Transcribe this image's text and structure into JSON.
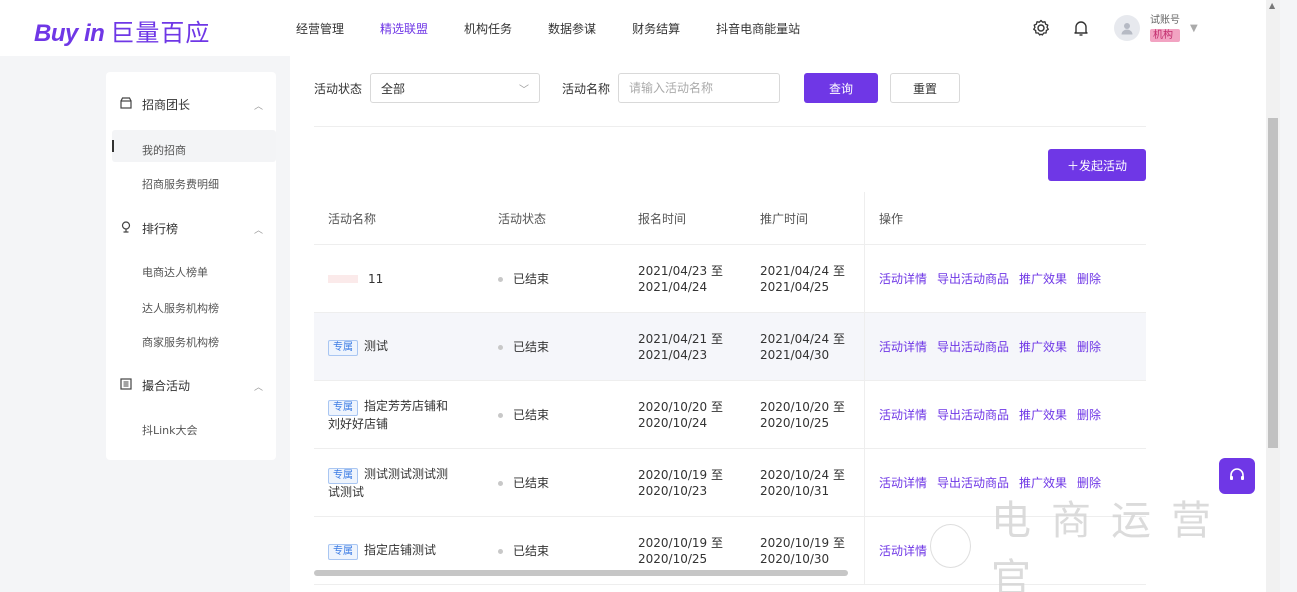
{
  "brand": {
    "logo_en": "Buy in",
    "logo_cn": "巨量百应",
    "accent": "#6f37e6"
  },
  "nav": [
    {
      "label": "经营管理",
      "active": false
    },
    {
      "label": "精选联盟",
      "active": true
    },
    {
      "label": "机构任务",
      "active": false
    },
    {
      "label": "数据参谋",
      "active": false
    },
    {
      "label": "财务结算",
      "active": false
    },
    {
      "label": "抖音电商能量站",
      "active": false
    }
  ],
  "header": {
    "icons": [
      "settings-icon",
      "bell-icon"
    ],
    "account_name": "试账号",
    "account_role": "机构"
  },
  "sidebar": {
    "sections": [
      {
        "title": "招商团长",
        "icon": "store-icon",
        "items": [
          "我的招商",
          "招商服务费明细"
        ]
      },
      {
        "title": "排行榜",
        "icon": "trophy-icon",
        "items": [
          "电商达人榜单",
          "达人服务机构榜",
          "商家服务机构榜"
        ]
      },
      {
        "title": "撮合活动",
        "icon": "match-icon",
        "items": [
          "抖Link大会"
        ]
      }
    ],
    "active_item": "我的招商"
  },
  "filter": {
    "status_label": "活动状态",
    "status_value": "全部",
    "name_label": "活动名称",
    "name_placeholder": "请输入活动名称",
    "query_button": "查询",
    "reset_button": "重置"
  },
  "launch_button": "＋发起活动",
  "table": {
    "headers": [
      "活动名称",
      "活动状态",
      "报名时间",
      "推广时间",
      "操作"
    ],
    "ops": [
      "活动详情",
      "导出活动商品",
      "推广效果",
      "删除"
    ],
    "rows": [
      {
        "tag": "",
        "name": "11",
        "status": "已结束",
        "signup_start": "2021/04/23 至",
        "signup_end": "2021/04/24",
        "promo_start": "2021/04/24 至",
        "promo_end": "2021/04/25"
      },
      {
        "tag": "专属",
        "name": "测试",
        "status": "已结束",
        "signup_start": "2021/04/21 至",
        "signup_end": "2021/04/23",
        "promo_start": "2021/04/24 至",
        "promo_end": "2021/04/30"
      },
      {
        "tag": "专属",
        "name": "指定芳芳店铺和",
        "name2": "刘好好店铺",
        "status": "已结束",
        "signup_start": "2020/10/20 至",
        "signup_end": "2020/10/24",
        "promo_start": "2020/10/20 至",
        "promo_end": "2020/10/25"
      },
      {
        "tag": "专属",
        "name": "测试测试测试测",
        "name2": "试测试",
        "status": "已结束",
        "signup_start": "2020/10/19 至",
        "signup_end": "2020/10/23",
        "promo_start": "2020/10/24 至",
        "promo_end": "2020/10/31"
      },
      {
        "tag": "专属",
        "name": "指定店铺测试",
        "status": "已结束",
        "signup_start": "2020/10/19 至",
        "signup_end": "2020/10/25",
        "promo_start": "2020/10/19 至",
        "promo_end": "2020/10/30"
      }
    ]
  },
  "watermark": "电商运营官"
}
